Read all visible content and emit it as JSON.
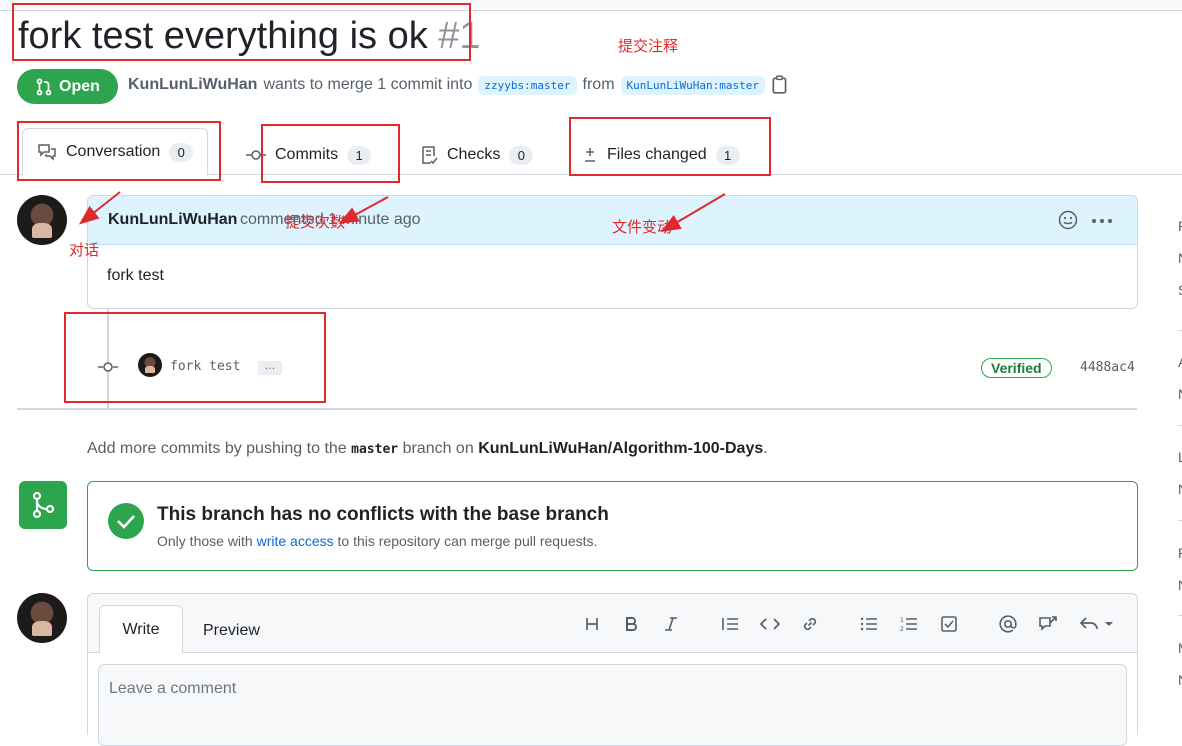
{
  "pr": {
    "title": "fork test everything is ok",
    "number": "#1",
    "state": "Open",
    "author": "KunLunLiWuHan",
    "merge_text": "wants to merge 1 commit into",
    "base_branch": "zzyybs:master",
    "from_text": "from",
    "head_branch": "KunLunLiWuHan:master"
  },
  "tabs": [
    {
      "label": "Conversation",
      "count": "0"
    },
    {
      "label": "Commits",
      "count": "1"
    },
    {
      "label": "Checks",
      "count": "0"
    },
    {
      "label": "Files changed",
      "count": "1"
    }
  ],
  "comment": {
    "author": "KunLunLiWuHan",
    "meta": "commented 1 minute ago",
    "body": "fork test"
  },
  "commit": {
    "message": "fork test",
    "ellipsis": "…",
    "verified": "Verified",
    "sha": "4488ac4"
  },
  "push_hint": {
    "prefix": "Add more commits by pushing to the",
    "branch": "master",
    "middle": "branch on",
    "repo": "KunLunLiWuHan/Algorithm-100-Days",
    "suffix": "."
  },
  "merge": {
    "title": "This branch has no conflicts with the base branch",
    "prefix": "Only those with",
    "link": "write access",
    "suffix": "to this repository can merge pull requests."
  },
  "editor": {
    "tab_write": "Write",
    "tab_preview": "Preview",
    "placeholder": "Leave a comment"
  },
  "sidebar_ticks": [
    "F",
    "N",
    "S",
    "A",
    "N",
    "L",
    "N",
    "P",
    "N",
    "M",
    "N"
  ],
  "annotations": {
    "title_note": "提交注释",
    "conversation_note": "对话",
    "commits_note": "提交次数",
    "files_note": "文件变动"
  },
  "colors": {
    "accent_green": "#2da44e",
    "link_blue": "#0969da",
    "annotation_red": "#e0292b"
  }
}
